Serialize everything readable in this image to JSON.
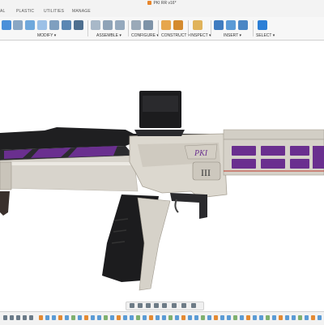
{
  "window": {
    "title": "PKI RR v16*"
  },
  "tabs": [
    "AL",
    "PLASTIC",
    "UTILITIES",
    "MANAGE"
  ],
  "ribbon": {
    "groups": [
      "MODIFY ▾",
      "ASSEMBLE ▾",
      "CONFIGURE ▾",
      "CONSTRUCT ▾",
      "INSPECT ▾",
      "INSERT ▾",
      "SELECT ▾"
    ]
  },
  "model": {
    "logo_text": "PKI",
    "marking_text": "III"
  },
  "colors": {
    "accent_blue": "#2c7fd6",
    "purple_panel": "#6a2f8f",
    "body_beige": "#d8d4cc",
    "dark_part": "#1f1f21"
  }
}
